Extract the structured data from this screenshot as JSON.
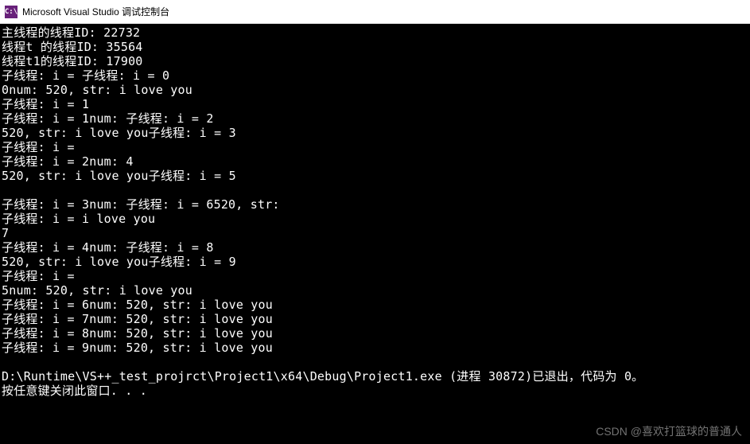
{
  "titlebar": {
    "icon_text": "C:\\",
    "title": "Microsoft Visual Studio 调试控制台"
  },
  "console": {
    "lines": [
      "主线程的线程ID: 22732",
      "线程t 的线程ID: 35564",
      "线程t1的线程ID: 17900",
      "子线程: i = 子线程: i = 0",
      "0num: 520, str: i love you",
      "子线程: i = 1",
      "子线程: i = 1num: 子线程: i = 2",
      "520, str: i love you子线程: i = 3",
      "子线程: i = ",
      "子线程: i = 2num: 4",
      "520, str: i love you子线程: i = 5",
      "",
      "子线程: i = 3num: 子线程: i = 6520, str: ",
      "子线程: i = i love you",
      "7",
      "子线程: i = 4num: 子线程: i = 8",
      "520, str: i love you子线程: i = 9",
      "子线程: i = ",
      "5num: 520, str: i love you",
      "子线程: i = 6num: 520, str: i love you",
      "子线程: i = 7num: 520, str: i love you",
      "子线程: i = 8num: 520, str: i love you",
      "子线程: i = 9num: 520, str: i love you",
      "",
      "D:\\Runtime\\VS++_test_projrct\\Project1\\x64\\Debug\\Project1.exe (进程 30872)已退出，代码为 0。",
      "按任意键关闭此窗口. . ."
    ]
  },
  "watermark": {
    "text": "CSDN @喜欢打篮球的普通人"
  }
}
